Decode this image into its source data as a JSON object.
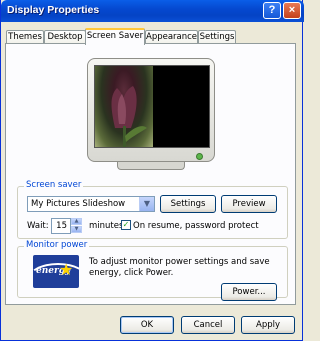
{
  "window": {
    "title": "Display Properties",
    "help_label": "?",
    "close_label": "×"
  },
  "tabs": [
    {
      "label": "Themes"
    },
    {
      "label": "Desktop"
    },
    {
      "label": "Screen Saver"
    },
    {
      "label": "Appearance"
    },
    {
      "label": "Settings"
    }
  ],
  "screensaver": {
    "group_label": "Screen saver",
    "selected": "My Pictures Slideshow",
    "settings_label": "Settings",
    "preview_label": "Preview",
    "wait_label": "Wait:",
    "wait_value": "15",
    "minutes_label": "minutes",
    "password_label": "On resume, password protect",
    "password_checked": true
  },
  "monitor_power": {
    "group_label": "Monitor power",
    "description": "To adjust monitor power settings and save energy, click Power.",
    "power_label": "Power...",
    "logo_text": "energy"
  },
  "footer": {
    "ok_label": "OK",
    "cancel_label": "Cancel",
    "apply_label": "Apply"
  }
}
